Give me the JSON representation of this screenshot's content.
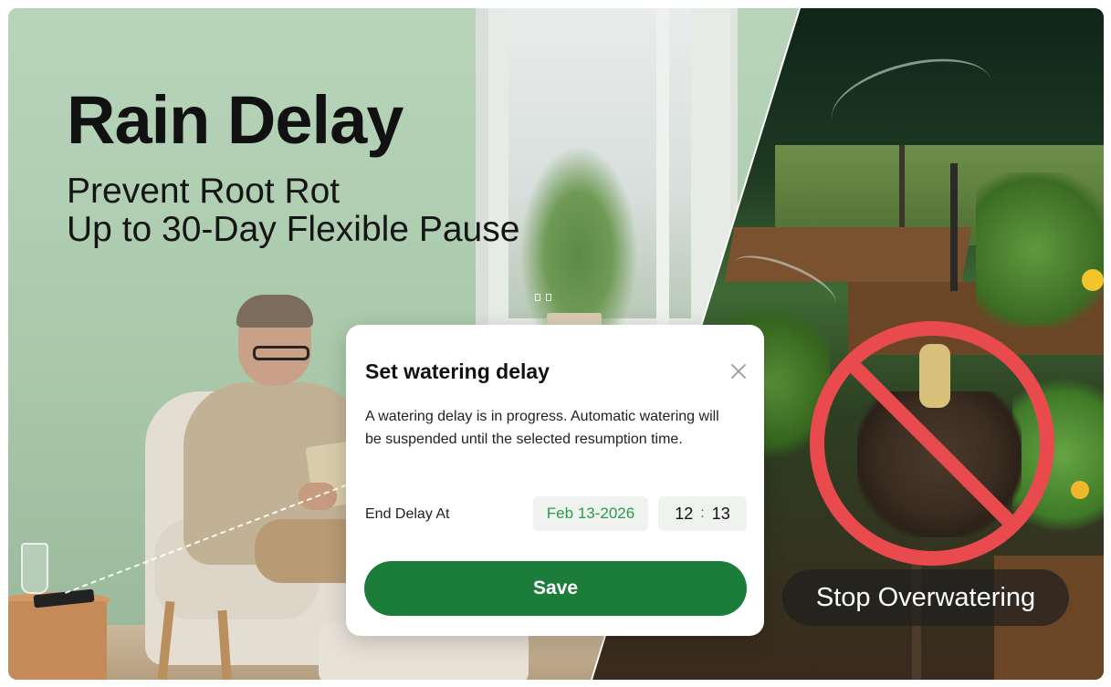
{
  "headline": {
    "title": "Rain Delay",
    "subtitle_line1": "Prevent Root Rot",
    "subtitle_line2": "Up to 30-Day Flexible Pause"
  },
  "dialog": {
    "title": "Set watering delay",
    "description": "A watering delay is in progress. Automatic watering will be suspended until the selected resumption time.",
    "end_label": "End Delay At",
    "date_value": "Feb 13-2026",
    "time_hour": "12",
    "time_separator": ":",
    "time_minute": "13",
    "save_label": "Save"
  },
  "badge": {
    "stop_label": "Stop Overwatering"
  },
  "colors": {
    "primary_green": "#1c7d3b",
    "date_green": "#2a9a4b",
    "no_sign_red": "#e84a4e"
  },
  "icons": {
    "close": "close-icon",
    "prohibition": "no-sign-icon"
  }
}
